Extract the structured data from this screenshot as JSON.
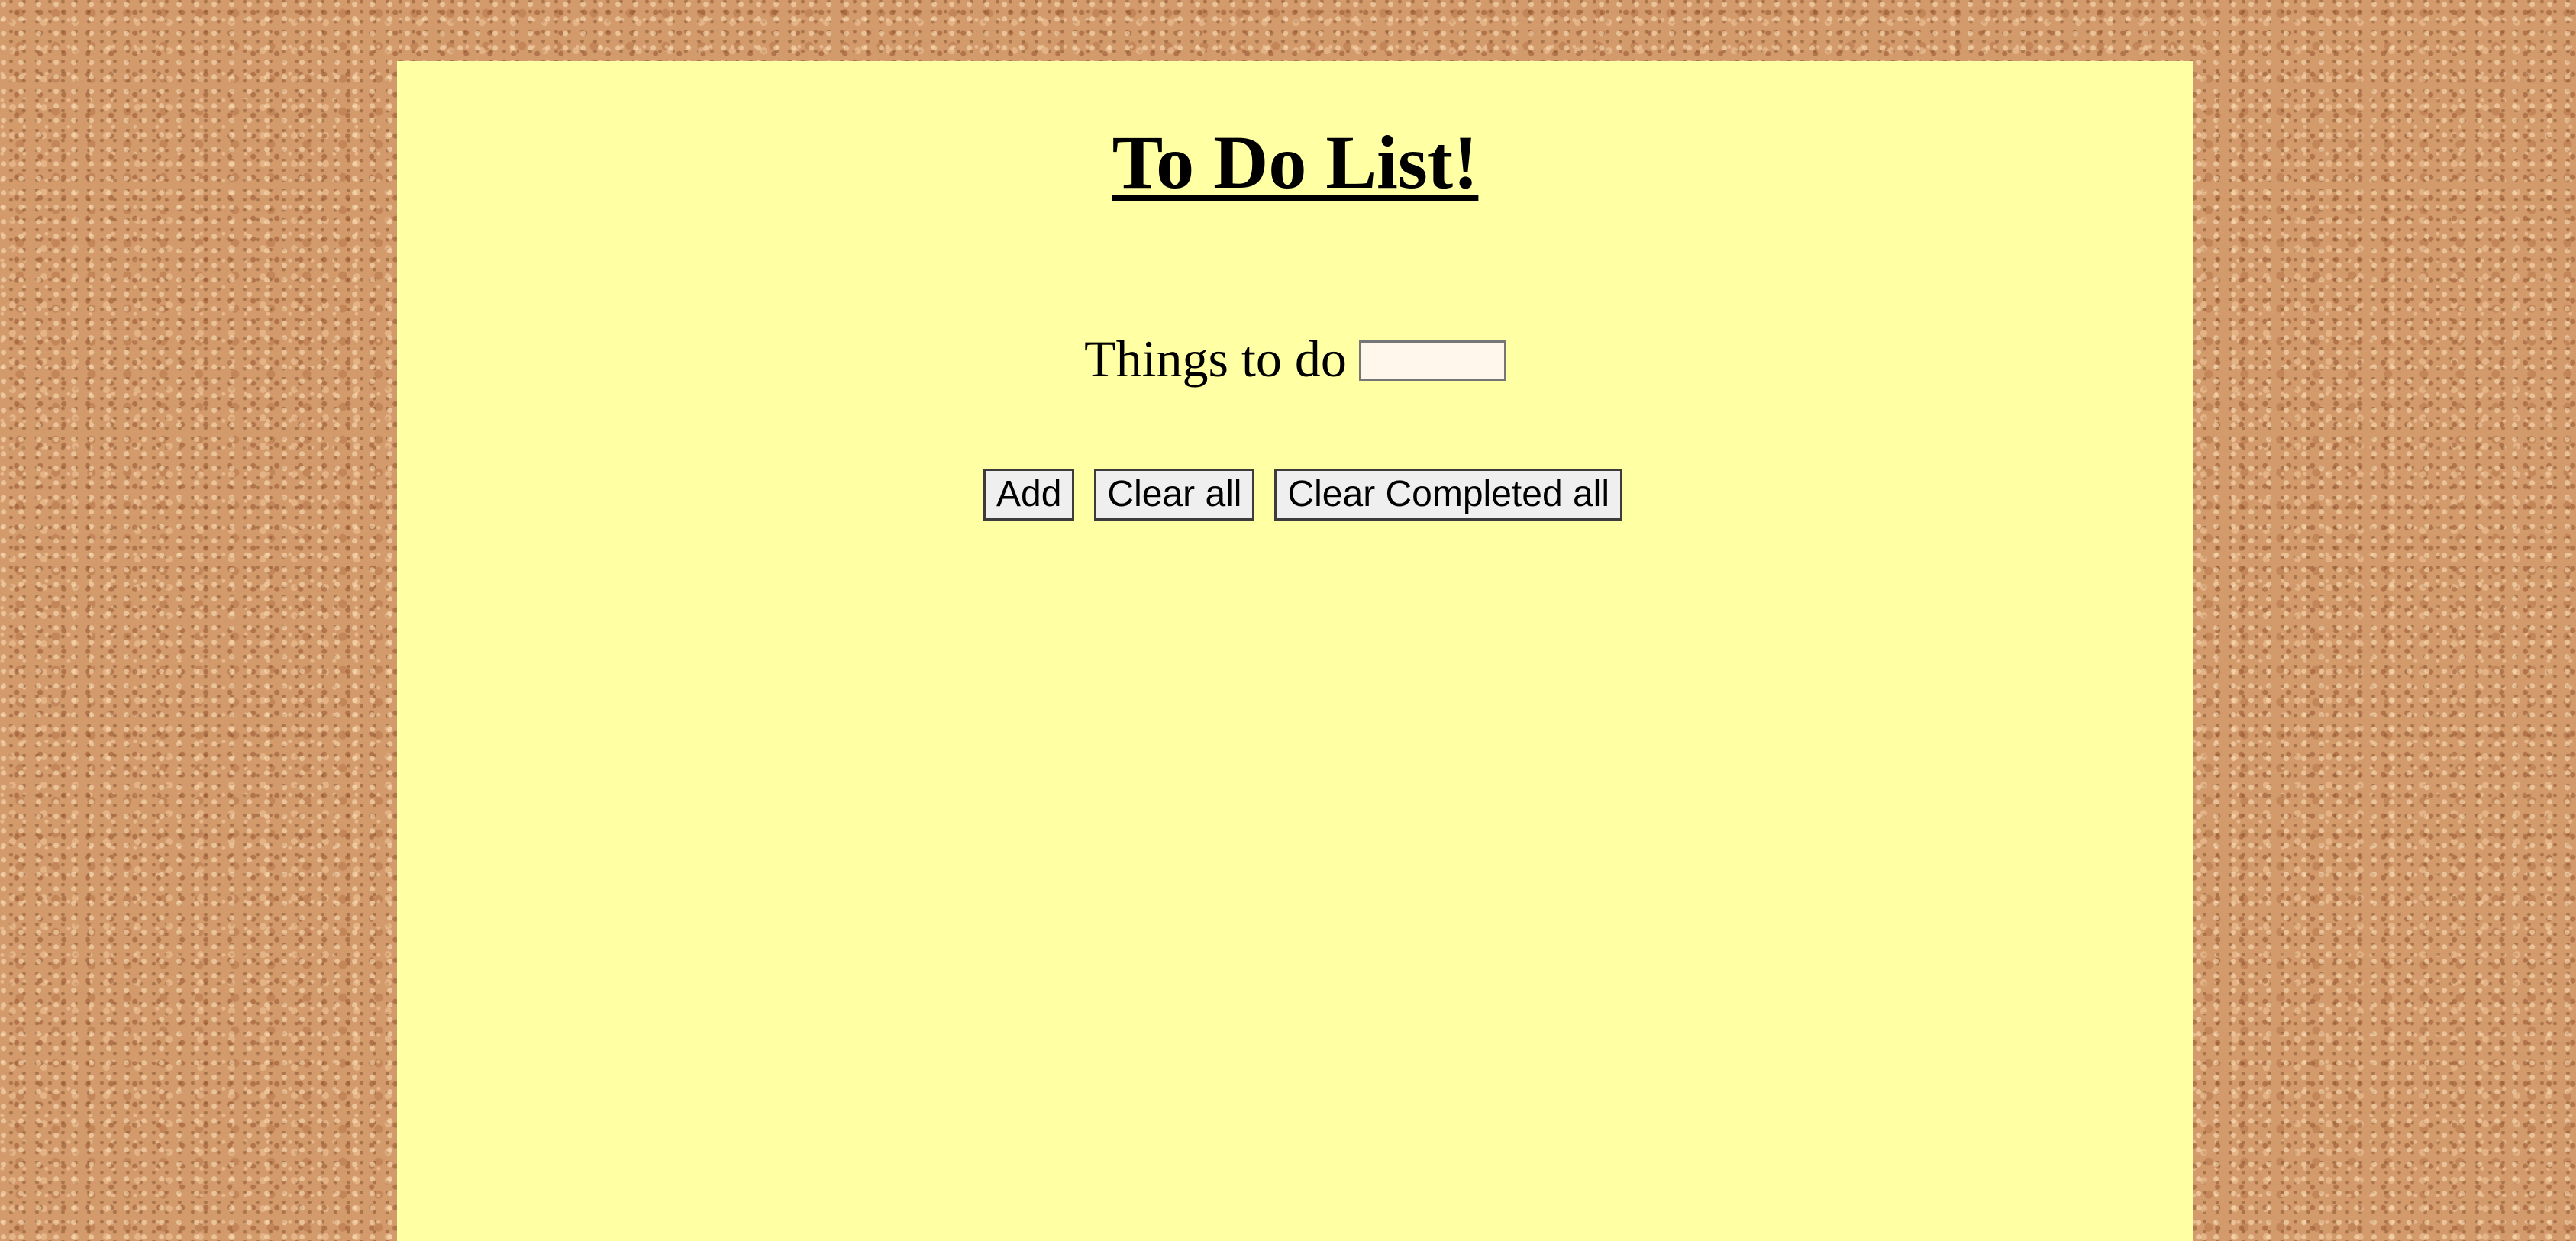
{
  "page": {
    "title": "To Do List!"
  },
  "form": {
    "label": "Things to do",
    "input_value": "",
    "input_placeholder": ""
  },
  "buttons": {
    "add": "Add",
    "clear_all": "Clear all",
    "clear_completed": "Clear Completed all"
  },
  "colors": {
    "paper": "#ffffa4",
    "corkboard": "#d39a6c"
  }
}
